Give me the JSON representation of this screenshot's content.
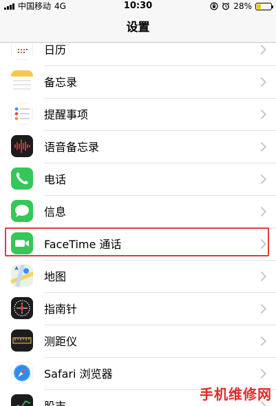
{
  "status_bar": {
    "carrier": "中国移动",
    "network": "4G",
    "time": "10:30",
    "battery_pct_label": "28%",
    "battery_level": 0.28,
    "icons": [
      "signal-icon",
      "rotation-lock-icon",
      "alarm-icon",
      "battery-icon"
    ]
  },
  "nav": {
    "title": "设置"
  },
  "items": [
    {
      "label": "日历",
      "icon": "calendar-icon"
    },
    {
      "label": "备忘录",
      "icon": "notes-icon"
    },
    {
      "label": "提醒事项",
      "icon": "reminders-icon"
    },
    {
      "label": "语音备忘录",
      "icon": "voice-memos-icon"
    },
    {
      "label": "电话",
      "icon": "phone-icon"
    },
    {
      "label": "信息",
      "icon": "messages-icon"
    },
    {
      "label": "FaceTime 通话",
      "icon": "facetime-icon",
      "highlighted": true
    },
    {
      "label": "地图",
      "icon": "maps-icon"
    },
    {
      "label": "指南针",
      "icon": "compass-icon"
    },
    {
      "label": "测距仪",
      "icon": "measure-icon"
    },
    {
      "label": "Safari 浏览器",
      "icon": "safari-icon"
    },
    {
      "label": "股市",
      "icon": "stocks-icon"
    }
  ],
  "colors": {
    "highlight_border": "#e23a3a",
    "watermark": "#e02b2b",
    "phone_green": "#34c759"
  },
  "watermark": "手机维修网"
}
